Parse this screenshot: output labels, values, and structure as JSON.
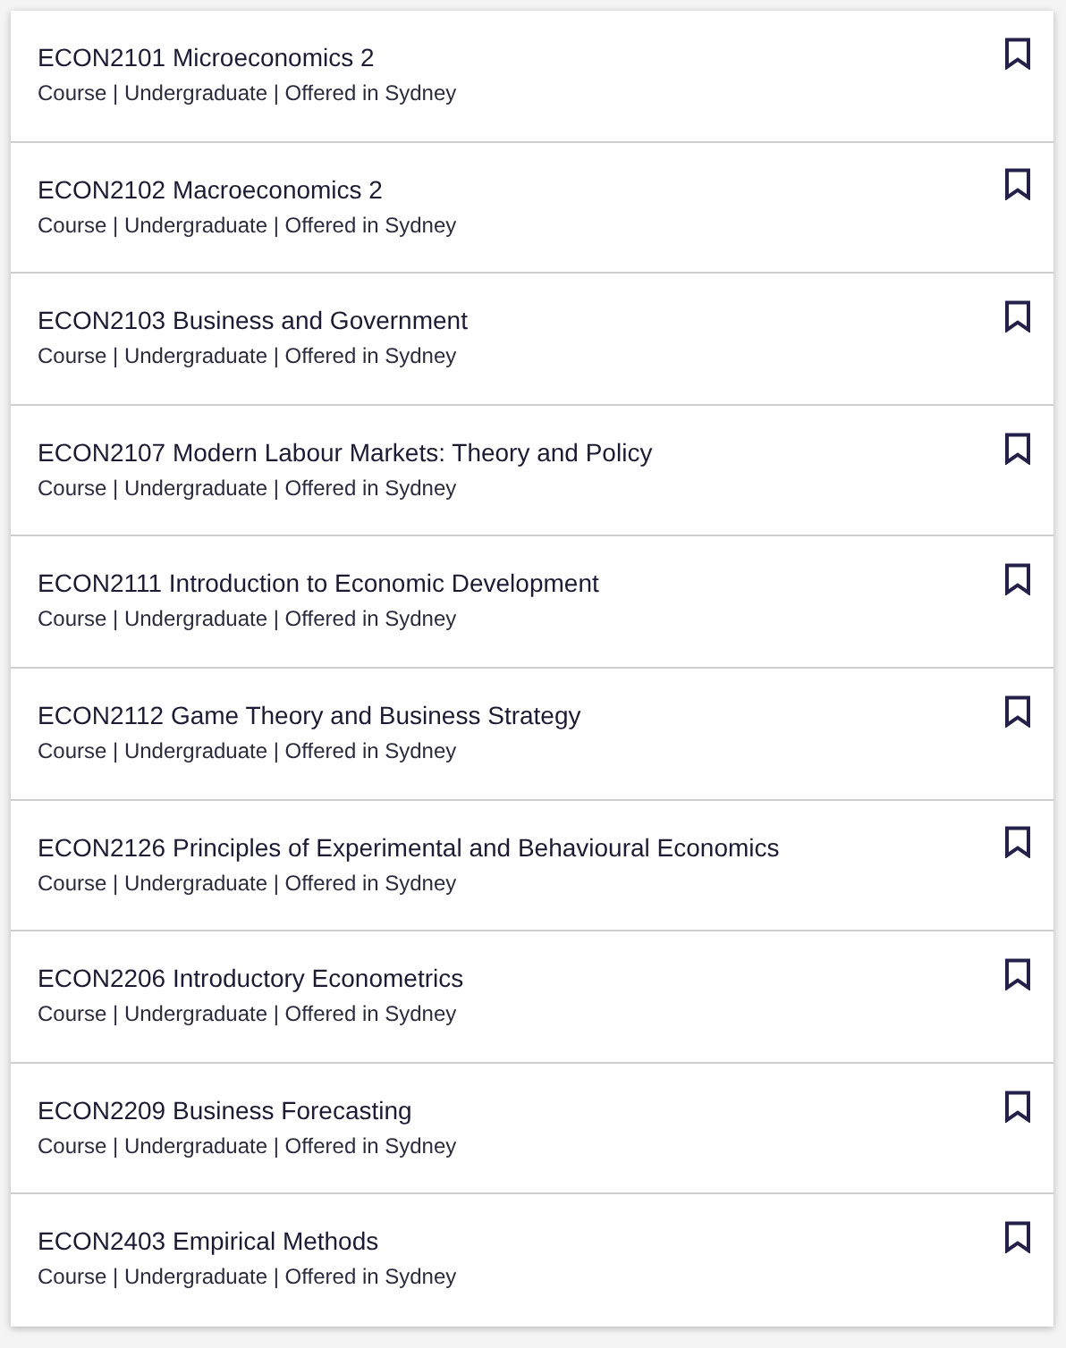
{
  "courses": [
    {
      "title": "ECON2101 Microeconomics 2",
      "meta": "Course | Undergraduate | Offered in Sydney"
    },
    {
      "title": "ECON2102 Macroeconomics 2",
      "meta": "Course | Undergraduate | Offered in Sydney"
    },
    {
      "title": "ECON2103 Business and Government",
      "meta": "Course | Undergraduate | Offered in Sydney"
    },
    {
      "title": "ECON2107 Modern Labour Markets: Theory and Policy",
      "meta": "Course | Undergraduate | Offered in Sydney"
    },
    {
      "title": "ECON2111 Introduction to Economic Development",
      "meta": "Course | Undergraduate | Offered in Sydney"
    },
    {
      "title": "ECON2112 Game Theory and Business Strategy",
      "meta": "Course | Undergraduate | Offered in Sydney"
    },
    {
      "title": "ECON2126 Principles of Experimental and Behavioural Economics",
      "meta": "Course | Undergraduate | Offered in Sydney"
    },
    {
      "title": "ECON2206 Introductory Econometrics",
      "meta": "Course | Undergraduate | Offered in Sydney"
    },
    {
      "title": "ECON2209 Business Forecasting",
      "meta": "Course | Undergraduate | Offered in Sydney"
    },
    {
      "title": "ECON2403 Empirical Methods",
      "meta": "Course | Undergraduate | Offered in Sydney"
    }
  ]
}
